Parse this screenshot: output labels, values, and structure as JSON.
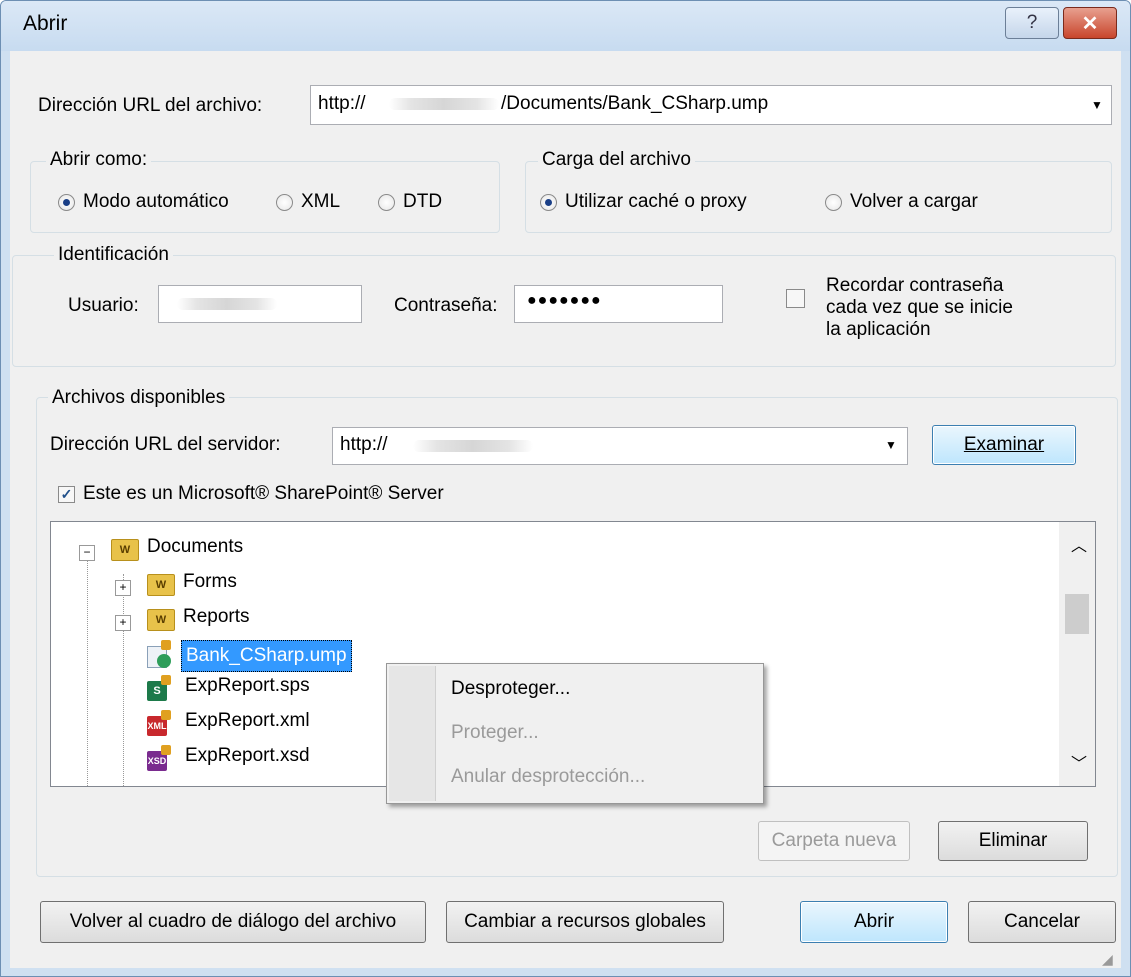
{
  "window": {
    "title": "Abrir",
    "help_label": "?",
    "close_label": "✕"
  },
  "url_row": {
    "label": "Dirección URL del archivo:",
    "value_prefix": "http://",
    "value_suffix": "/Documents/Bank_CSharp.ump"
  },
  "open_as": {
    "title": "Abrir como:",
    "options": [
      {
        "label": "Modo automático",
        "selected": true
      },
      {
        "label": "XML",
        "selected": false
      },
      {
        "label": "DTD",
        "selected": false
      }
    ]
  },
  "load": {
    "title": "Carga del archivo",
    "options": [
      {
        "label": "Utilizar caché o proxy",
        "selected": true
      },
      {
        "label": "Volver a cargar",
        "selected": false
      }
    ]
  },
  "identification": {
    "title": "Identificación",
    "user_label": "Usuario:",
    "password_label": "Contraseña:",
    "password_value": "●●●●●●●",
    "remember_line1": "Recordar contraseña",
    "remember_line2": "cada vez que se inicie",
    "remember_line3": "la aplicación",
    "remember_checked": false
  },
  "available": {
    "title": "Archivos disponibles",
    "server_label": "Dirección URL del servidor:",
    "server_value": "http://",
    "browse_label": "Examinar",
    "sharepoint_label": "Este es un Microsoft® SharePoint® Server",
    "sharepoint_checked": true
  },
  "tree": {
    "items": [
      {
        "label": "Documents",
        "icon": "sharepoint-folder-icon",
        "expander": "−"
      },
      {
        "label": "Forms",
        "icon": "sharepoint-folder-icon",
        "expander": "+"
      },
      {
        "label": "Reports",
        "icon": "sharepoint-folder-icon",
        "expander": "+"
      },
      {
        "label": "Bank_CSharp.ump",
        "icon": "ump-checked-out-file-icon",
        "selected": true
      },
      {
        "label": "ExpReport.sps",
        "icon": "sps-locked-file-icon"
      },
      {
        "label": "ExpReport.xml",
        "icon": "xml-locked-file-icon"
      },
      {
        "label": "ExpReport.xsd",
        "icon": "xsd-locked-file-icon"
      }
    ]
  },
  "context_menu": {
    "items": [
      {
        "label": "Desproteger...",
        "enabled": true
      },
      {
        "label": "Proteger...",
        "enabled": false
      },
      {
        "label": "Anular desprotección...",
        "enabled": false
      }
    ]
  },
  "file_buttons": {
    "new_folder": "Carpeta nueva",
    "delete": "Eliminar"
  },
  "footer": {
    "back": "Volver al cuadro de diálogo del archivo",
    "global": "Cambiar a recursos globales",
    "open": "Abrir",
    "cancel": "Cancelar"
  },
  "icon_colors": {
    "folder": "#e8c24a",
    "selection": "#3399ff",
    "sps": "#1d7a4a",
    "xml": "#c8282d",
    "xsd": "#7a2b8f",
    "lock": "#e0a020"
  }
}
